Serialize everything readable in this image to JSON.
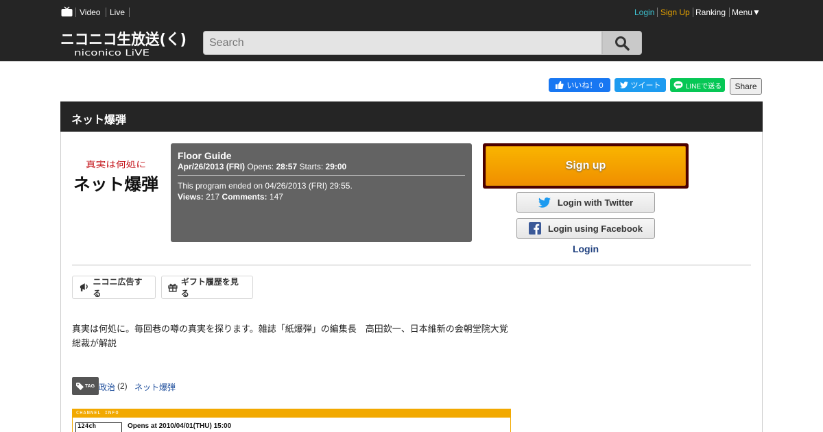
{
  "colors": {
    "header_bg": "#252525",
    "accent_login": "#3ec3d2",
    "accent_signup": "#e9a400",
    "signup_orange": "#f5a000",
    "signup_border": "#4c0000",
    "floor_guide_bg": "#636363",
    "link_blue": "#1e4e9c",
    "channel_orange": "#f2a900"
  },
  "header": {
    "tv_icon": "tv-icon",
    "nav": {
      "video": "Video",
      "live": "Live"
    },
    "account": {
      "login": "Login",
      "signup": "Sign Up",
      "ranking": "Ranking",
      "menu": "Menu▼"
    },
    "logo": {
      "main": "ニコニコ生放送(く)",
      "sub": "niconico LiVE"
    },
    "search": {
      "placeholder": "Search",
      "icon": "search-icon"
    }
  },
  "social": {
    "fb_like": "いいね！ 0",
    "tweet": "ツイート",
    "line": "LINEで送る",
    "share": "Share"
  },
  "program": {
    "title": "ネット爆弾",
    "thumbnail": {
      "top_text": "真実は何処に",
      "main_text": "ネット爆弾"
    },
    "floor_guide": {
      "title": "Floor Guide",
      "date": "Apr/26/2013 (FRI)",
      "opens_label": "Opens:",
      "opens_time": "28:57",
      "starts_label": "Starts:",
      "starts_time": "29:00",
      "ended_text": "This program ended on 04/26/2013 (FRI) 29:55.",
      "views_label": "Views:",
      "views": "217",
      "comments_label": "Comments:",
      "comments": "147"
    },
    "signup_button": "Sign up",
    "twitter_login": "Login with Twitter",
    "facebook_login": "Login using Facebook",
    "login_link": "Login",
    "actions": {
      "ad": "ニコニ広告する",
      "gift": "ギフト履歴を見る"
    },
    "description": "真実は何処に。毎回巷の噂の真実を探ります。雑誌「紙爆弾」の編集長　高田欽一、日本維新の会朝堂院大覚総裁が解説",
    "tags": {
      "icon_label": "TAG",
      "items": [
        {
          "label": "政治",
          "count": "(2)"
        },
        {
          "label": "ネット爆弾",
          "count": ""
        }
      ]
    },
    "channel": {
      "strip_label": "CHANNEL INFO",
      "logo_text": "124ch",
      "opens": "Opens at 2010/04/01(THU) 15:00"
    }
  }
}
